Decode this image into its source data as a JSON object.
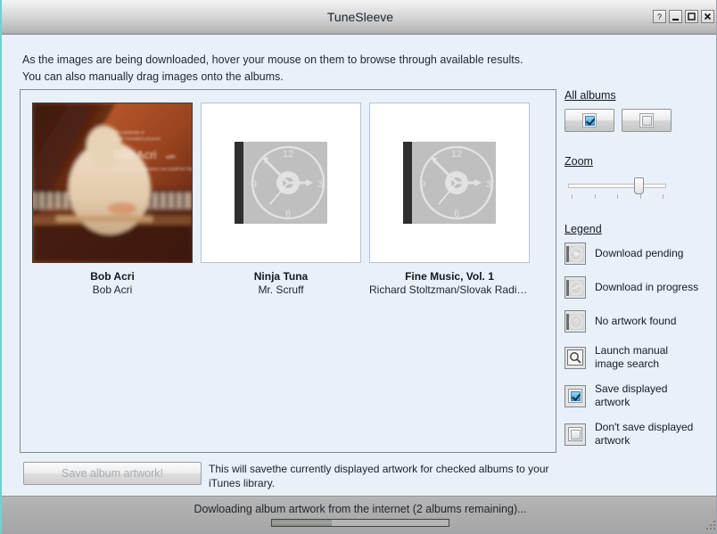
{
  "window": {
    "title": "TuneSleeve",
    "buttons": [
      {
        "name": "help-button",
        "glyph": "?"
      },
      {
        "name": "minimize-button",
        "glyph": "_"
      },
      {
        "name": "maximize-button",
        "glyph": "□"
      },
      {
        "name": "close-button",
        "glyph": "✕"
      }
    ]
  },
  "instructions": {
    "line1": "As the images are being downloaded, hover your mouse on them to browse through available results.",
    "line2": "You can also manually drag images onto the albums."
  },
  "albums": [
    {
      "title": "Bob Acri",
      "artist": "Bob Acri",
      "state": "artwork-found"
    },
    {
      "title": "Ninja Tuna",
      "artist": "Mr. Scruff",
      "state": "download-pending"
    },
    {
      "title": "Fine Music, Vol. 1",
      "artist": "Richard Stoltzman/Slovak Radio Sym...",
      "state": "download-pending"
    }
  ],
  "sidebar": {
    "all_albums_heading": "All albums",
    "all_albums_buttons": [
      {
        "name": "check-all-albums-button",
        "icon": "checked-checkbox-icon"
      },
      {
        "name": "uncheck-all-albums-button",
        "icon": "unchecked-checkbox-icon"
      }
    ],
    "zoom_heading": "Zoom",
    "zoom": {
      "value": 4,
      "min": 1,
      "max": 5,
      "ticks": 5
    },
    "legend_heading": "Legend",
    "legend": [
      {
        "icon": "download-pending-icon",
        "label": "Download pending"
      },
      {
        "icon": "download-in-progress-icon",
        "label": "Download in progress"
      },
      {
        "icon": "no-artwork-found-icon",
        "label": "No artwork found"
      },
      {
        "icon": "manual-image-search-icon",
        "label": "Launch manual image search"
      },
      {
        "icon": "save-artwork-checkbox-icon",
        "label": "Save displayed artwork"
      },
      {
        "icon": "dont-save-artwork-checkbox-icon",
        "label": "Don't save displayed artwork"
      }
    ]
  },
  "footer": {
    "save_button_label": "Save album artwork!",
    "save_note": "This will savethe currently displayed artwork for checked albums to your iTunes library."
  },
  "status": {
    "message": "Dowloading album artwork from the internet (2 albums remaining)...",
    "progress_percent": 34
  },
  "colors": {
    "accent": "#2c9ede",
    "panel_bg": "#eaf0f8",
    "titlebar_edge": "#77cfd0"
  }
}
